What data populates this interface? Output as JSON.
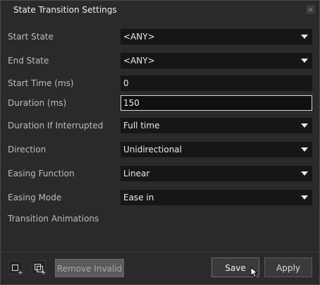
{
  "dialog": {
    "title": "State Transition Settings",
    "close_glyph": "×"
  },
  "fields": [
    {
      "label": "Start State",
      "value": "<ANY>",
      "type": "dropdown"
    },
    {
      "label": "End State",
      "value": "<ANY>",
      "type": "dropdown"
    },
    {
      "label": "Start Time (ms)",
      "value": "0",
      "type": "text"
    },
    {
      "label": "Duration (ms)",
      "value": "150",
      "type": "text-active"
    },
    {
      "label": "Duration If Interrupted",
      "value": "Full time",
      "type": "dropdown"
    },
    {
      "label": "Direction",
      "value": "Unidirectional",
      "type": "dropdown"
    },
    {
      "label": "Easing Function",
      "value": "Linear",
      "type": "dropdown"
    },
    {
      "label": "Easing Mode",
      "value": "Ease in",
      "type": "dropdown"
    }
  ],
  "section": {
    "transition_animations_label": "Transition Animations"
  },
  "footer": {
    "add_animation_icon": "add-animation-icon",
    "add_multiple_animation_icon": "add-multiple-animation-icon",
    "remove_invalid_label": "Remove Invalid",
    "save_label": "Save",
    "apply_label": "Apply"
  }
}
